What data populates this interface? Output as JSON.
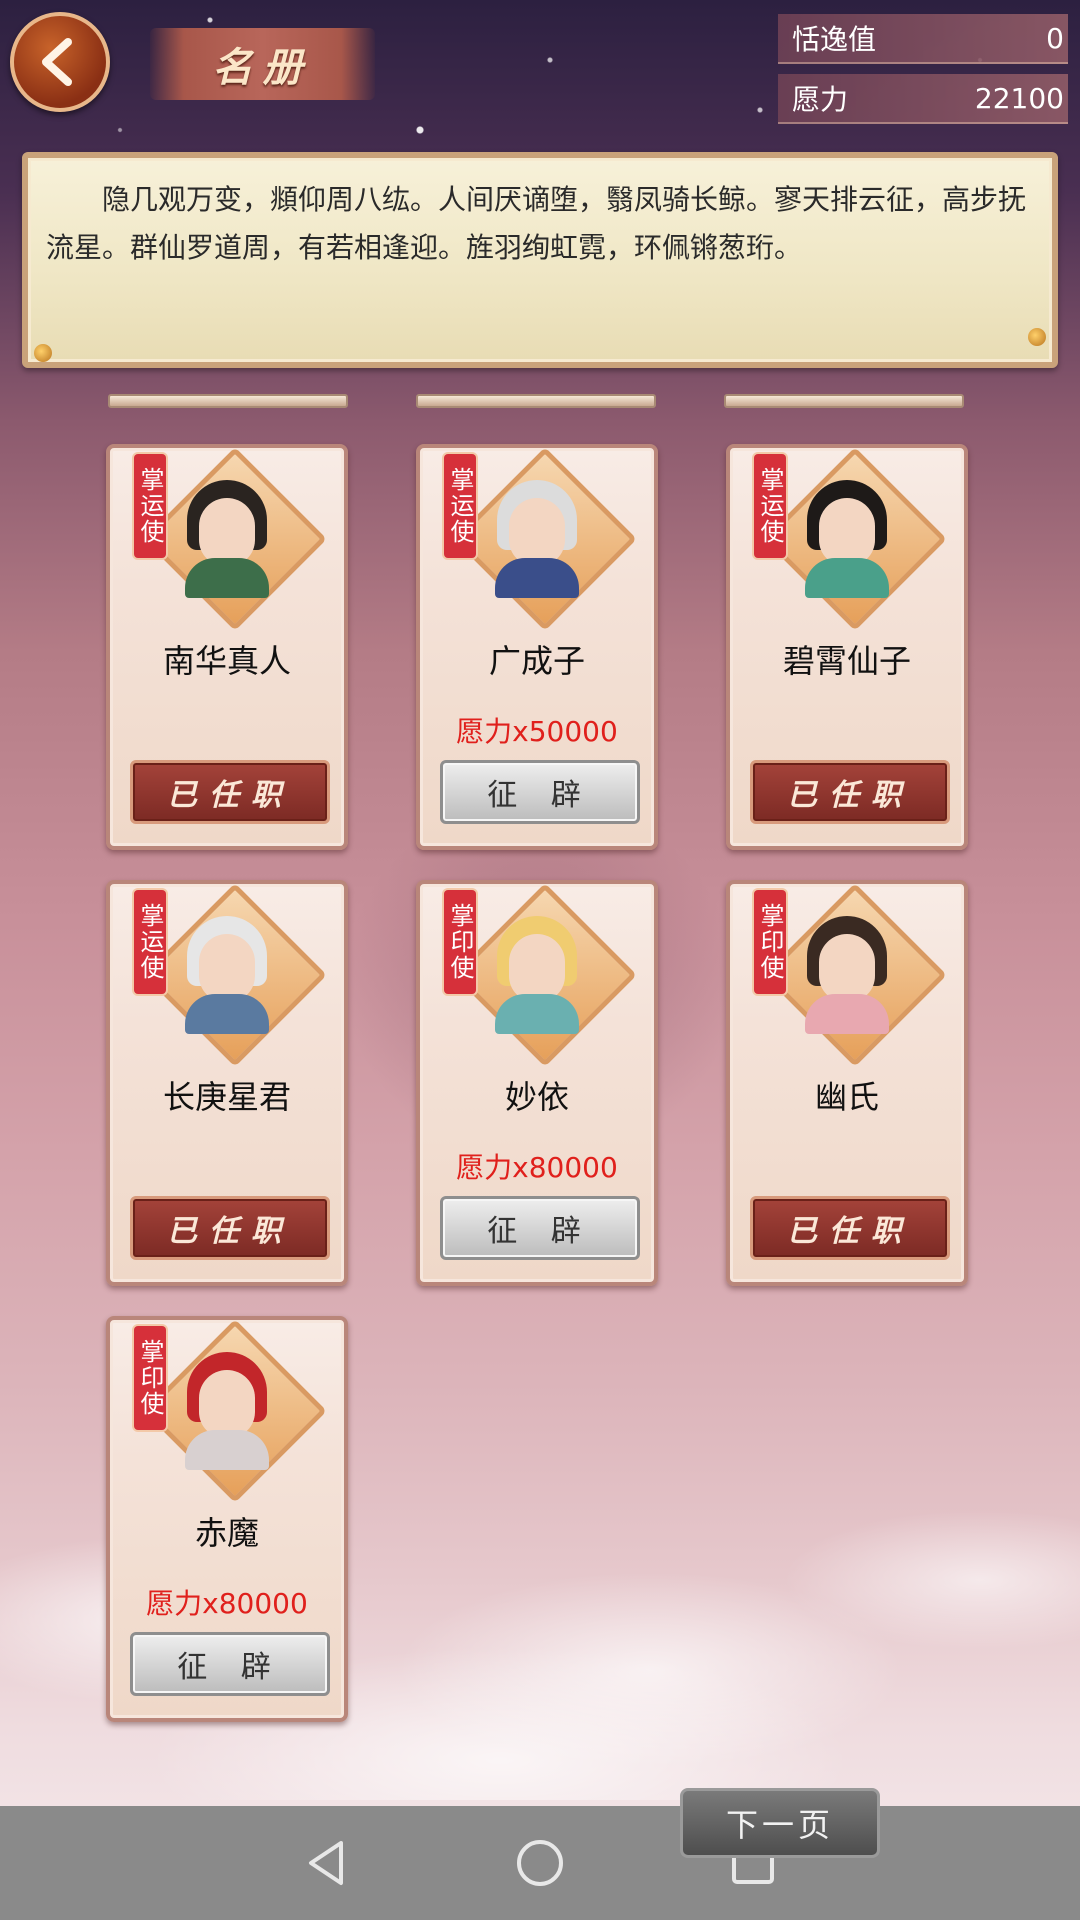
{
  "header": {
    "title": "名册",
    "stats": [
      {
        "label": "恬逸值",
        "value": "0"
      },
      {
        "label": "愿力",
        "value": "22100"
      }
    ]
  },
  "intro_text": "隐几观万变，頫仰周八纮。人间厌谪堕，翳凤骑长鲸。寥天排云征，高步抚流星。群仙罗道周，有若相逢迎。旌羽绚虹霓，环佩锵葱珩。",
  "cards": [
    {
      "tag": "掌运使",
      "name": "南华真人",
      "price": "",
      "button": "已任职",
      "status": "hired"
    },
    {
      "tag": "掌运使",
      "name": "广成子",
      "price": "愿力x50000",
      "button": "征 辟",
      "status": "recruit"
    },
    {
      "tag": "掌运使",
      "name": "碧霄仙子",
      "price": "",
      "button": "已任职",
      "status": "hired"
    },
    {
      "tag": "掌运使",
      "name": "长庚星君",
      "price": "",
      "button": "已任职",
      "status": "hired"
    },
    {
      "tag": "掌印使",
      "name": "妙依",
      "price": "愿力x80000",
      "button": "征 辟",
      "status": "recruit"
    },
    {
      "tag": "掌印使",
      "name": "幽氏",
      "price": "",
      "button": "已任职",
      "status": "hired"
    },
    {
      "tag": "掌印使",
      "name": "赤魔",
      "price": "愿力x80000",
      "button": "征 辟",
      "status": "recruit"
    }
  ],
  "next_page_label": "下一页",
  "colors": {
    "price": "#e0201c",
    "tag": "#d6303a",
    "hired_button": "#8c3028"
  },
  "icons": {
    "back": "chevron-left-icon",
    "nav_back": "triangle-back-icon",
    "nav_home": "circle-home-icon",
    "nav_recent": "square-recent-icon"
  }
}
